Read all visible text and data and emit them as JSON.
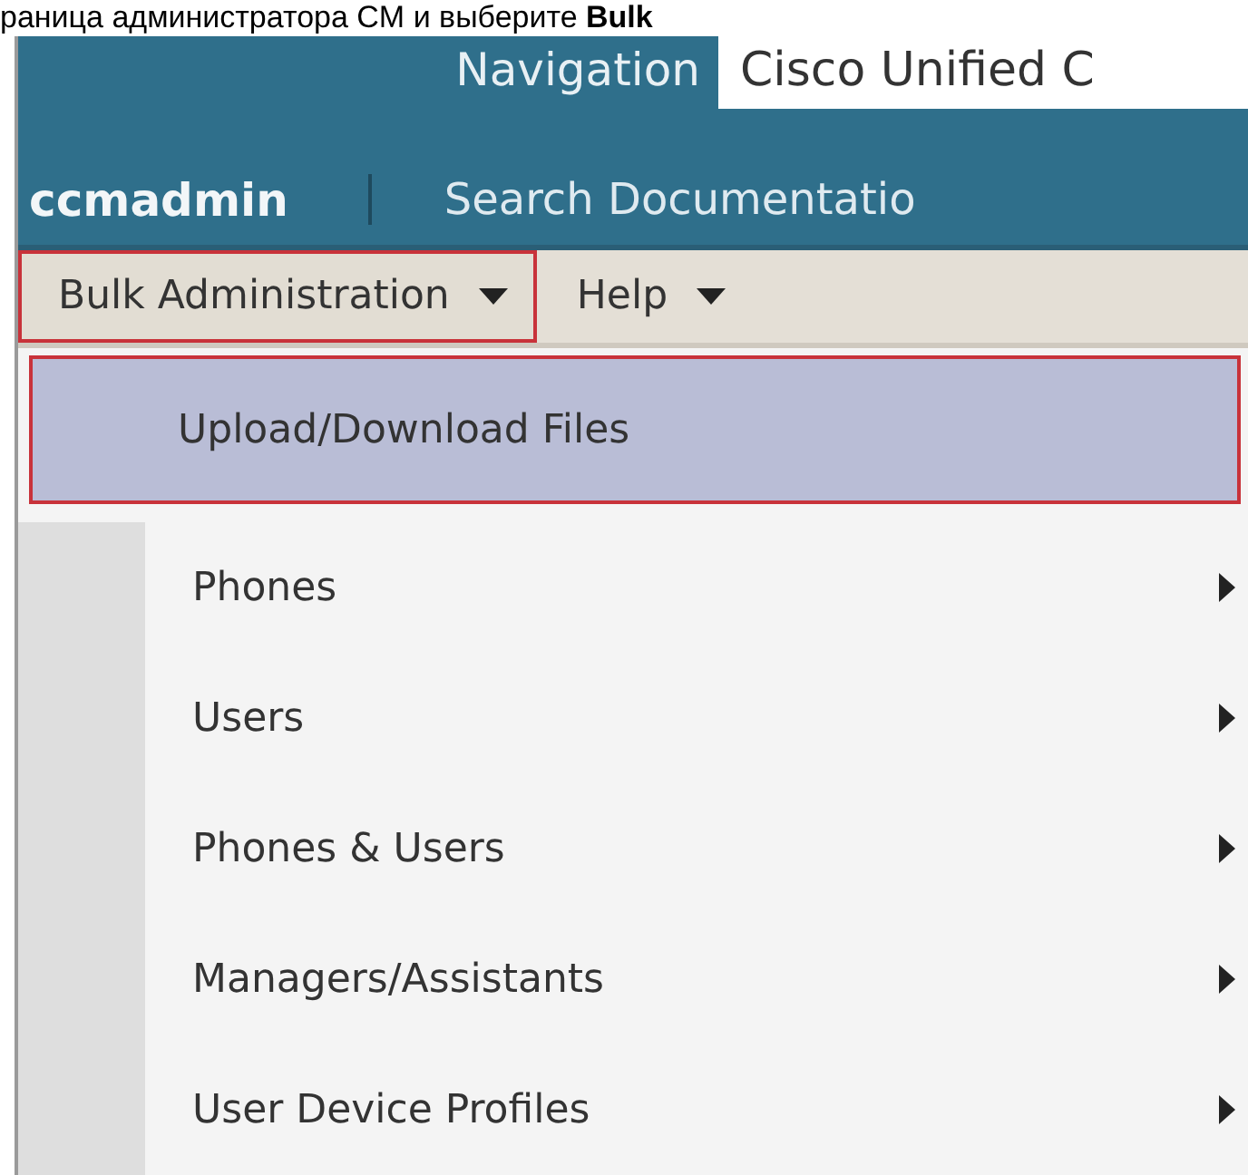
{
  "caption": "раница администратора CM и выберите **Bulk**",
  "header": {
    "navigation_label": "Navigation",
    "product_title": "Cisco Unified C",
    "user": "ccmadmin",
    "link": "Search Documentatio"
  },
  "menubar": [
    {
      "label": "Bulk Administration",
      "selected": true
    },
    {
      "label": "Help",
      "selected": false
    }
  ],
  "dropdown": [
    {
      "label": "Upload/Download Files",
      "selected": true,
      "submenu": false
    },
    {
      "label": "Phones",
      "selected": false,
      "submenu": true
    },
    {
      "label": "Users",
      "selected": false,
      "submenu": true
    },
    {
      "label": "Phones & Users",
      "selected": false,
      "submenu": true
    },
    {
      "label": "Managers/Assistants",
      "selected": false,
      "submenu": true
    },
    {
      "label": "User Device Profiles",
      "selected": false,
      "submenu": true
    }
  ]
}
